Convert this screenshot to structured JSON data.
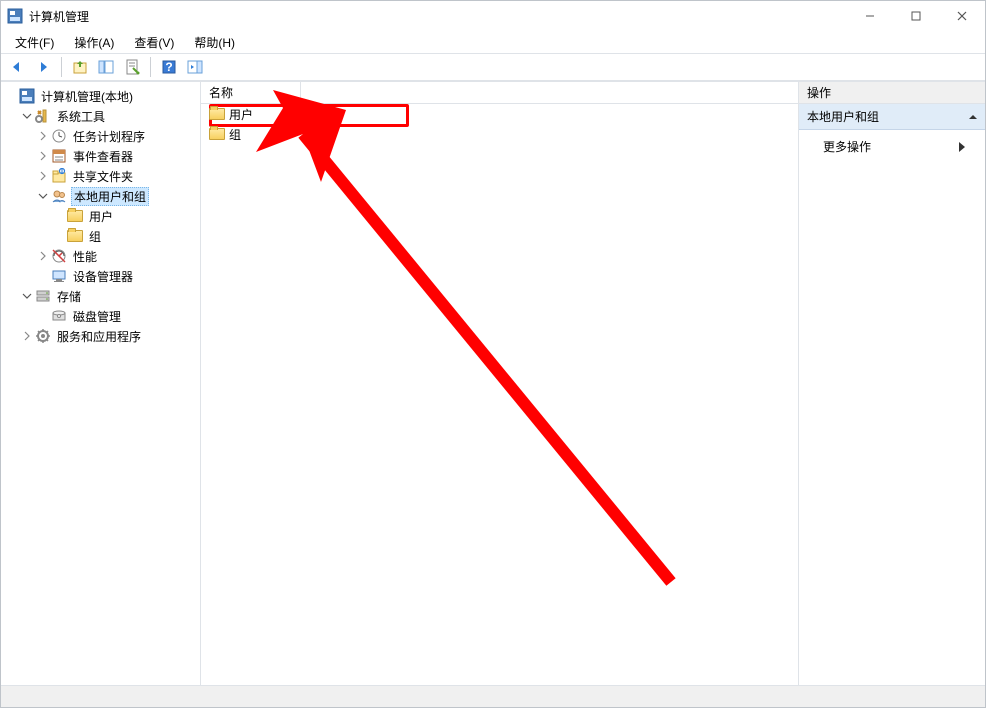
{
  "window": {
    "title": "计算机管理"
  },
  "menu": {
    "items": [
      {
        "label": "文件(F)"
      },
      {
        "label": "操作(A)"
      },
      {
        "label": "查看(V)"
      },
      {
        "label": "帮助(H)"
      }
    ]
  },
  "tree": {
    "nodes": [
      {
        "label": "计算机管理(本地)",
        "indent": 0,
        "expander": "none",
        "icon": "mgmt",
        "selected": false
      },
      {
        "label": "系统工具",
        "indent": 1,
        "expander": "open",
        "icon": "tools",
        "selected": false
      },
      {
        "label": "任务计划程序",
        "indent": 2,
        "expander": "closed",
        "icon": "clock",
        "selected": false
      },
      {
        "label": "事件查看器",
        "indent": 2,
        "expander": "closed",
        "icon": "event",
        "selected": false
      },
      {
        "label": "共享文件夹",
        "indent": 2,
        "expander": "closed",
        "icon": "share",
        "selected": false
      },
      {
        "label": "本地用户和组",
        "indent": 2,
        "expander": "open",
        "icon": "users",
        "selected": true
      },
      {
        "label": "用户",
        "indent": 3,
        "expander": "none",
        "icon": "folder",
        "selected": false
      },
      {
        "label": "组",
        "indent": 3,
        "expander": "none",
        "icon": "folder",
        "selected": false
      },
      {
        "label": "性能",
        "indent": 2,
        "expander": "closed",
        "icon": "perf",
        "selected": false
      },
      {
        "label": "设备管理器",
        "indent": 2,
        "expander": "none",
        "icon": "device",
        "selected": false
      },
      {
        "label": "存储",
        "indent": 1,
        "expander": "open",
        "icon": "storage",
        "selected": false
      },
      {
        "label": "磁盘管理",
        "indent": 2,
        "expander": "none",
        "icon": "disk",
        "selected": false
      },
      {
        "label": "服务和应用程序",
        "indent": 1,
        "expander": "closed",
        "icon": "services",
        "selected": false
      }
    ]
  },
  "list": {
    "header": "名称",
    "items": [
      {
        "label": "用户"
      },
      {
        "label": "组"
      }
    ]
  },
  "actions": {
    "title": "操作",
    "context": "本地用户和组",
    "items": [
      {
        "label": "更多操作"
      }
    ]
  }
}
